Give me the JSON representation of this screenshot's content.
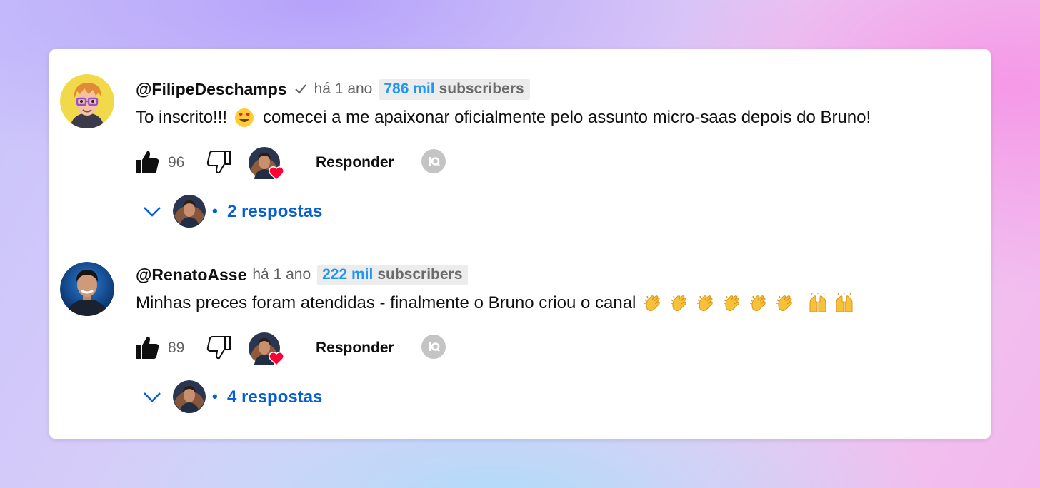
{
  "comments": [
    {
      "handle": "@FilipeDeschamps",
      "verified": true,
      "time": "há 1 ano",
      "subs_count": "786 mil",
      "subs_label": "subscribers",
      "text_before": "To inscrito!!!",
      "text_emoji": "smiling-face-with-heart-eyes",
      "text_after": "comecei a me apaixonar oficialmente pelo assunto micro-saas depois do Bruno!",
      "likes": "96",
      "reply_label": "Responder",
      "replies_label": "2 respostas",
      "dot": "•"
    },
    {
      "handle": "@RenatoAsse",
      "verified": false,
      "time": "há 1 ano",
      "subs_count": "222 mil",
      "subs_label": "subscribers",
      "text": "Minhas preces foram atendidas - finalmente o Bruno criou o canal",
      "text_emojis": [
        "clapping-hands",
        "clapping-hands",
        "clapping-hands",
        "clapping-hands",
        "clapping-hands",
        "clapping-hands",
        "raising-hands",
        "raising-hands"
      ],
      "likes": "89",
      "reply_label": "Responder",
      "replies_label": "4 respostas",
      "dot": "•"
    }
  ],
  "colors": {
    "link_blue": "#065fd4",
    "subs_blue": "#2196f3",
    "heart_red": "#ff0033",
    "muted": "#606060"
  }
}
